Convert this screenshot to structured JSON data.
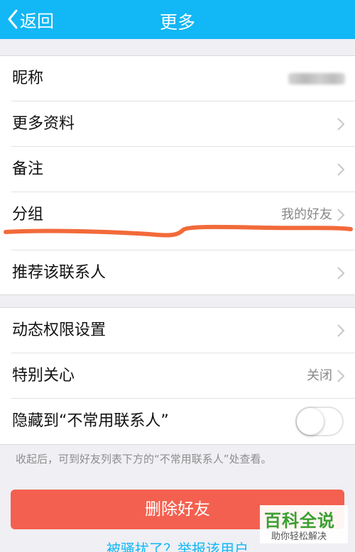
{
  "header": {
    "back_label": "返回",
    "title": "更多"
  },
  "section1": {
    "nickname": {
      "label": "昵称"
    },
    "more_info": {
      "label": "更多资料"
    },
    "remark": {
      "label": "备注"
    },
    "group": {
      "label": "分组",
      "value": "我的好友"
    },
    "recommend": {
      "label": "推荐该联系人"
    }
  },
  "section2": {
    "permissions": {
      "label": "动态权限设置"
    },
    "special_care": {
      "label": "特别关心",
      "value": "关闭"
    },
    "hide": {
      "label": "隐藏到“不常用联系人”",
      "toggle_on": false
    }
  },
  "hint": "收起后，可到好友列表下方的“不常用联系人”处查看。",
  "delete_button": "删除好友",
  "report_link": "被骚扰了？举报该用户",
  "watermark": {
    "main": "百科全说",
    "sub": "助你轻松解决"
  },
  "colors": {
    "navbar": "#12b7f5",
    "delete": "#f4604f",
    "annotation": "#f26a3a",
    "link": "#12b7f5"
  }
}
